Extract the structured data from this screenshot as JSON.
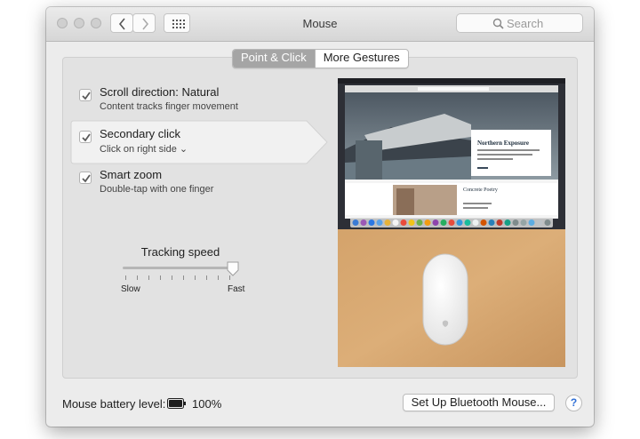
{
  "window": {
    "title": "Mouse"
  },
  "search": {
    "placeholder": "Search"
  },
  "tabs": [
    {
      "label": "Point & Click",
      "active": true
    },
    {
      "label": "More Gestures",
      "active": false
    }
  ],
  "options": [
    {
      "title": "Scroll direction: Natural",
      "subtitle": "Content tracks finger movement",
      "checked": true
    },
    {
      "title": "Secondary click",
      "subtitle": "Click on right side ⌄",
      "checked": true
    },
    {
      "title": "Smart zoom",
      "subtitle": "Double-tap with one finger",
      "checked": true
    }
  ],
  "tracking": {
    "label": "Tracking speed",
    "min_label": "Slow",
    "max_label": "Fast",
    "value_fraction": 1.0
  },
  "preview": {
    "article_title": "Northern Exposure",
    "article2_title": "Concrete Poetry"
  },
  "footer": {
    "battery_label": "Mouse battery level:",
    "battery_percent": "100%",
    "setup_button": "Set Up Bluetooth Mouse...",
    "help": "?"
  },
  "colors": {
    "selected_tab": "#a5a5a5",
    "help_accent": "#2f6fd6"
  }
}
